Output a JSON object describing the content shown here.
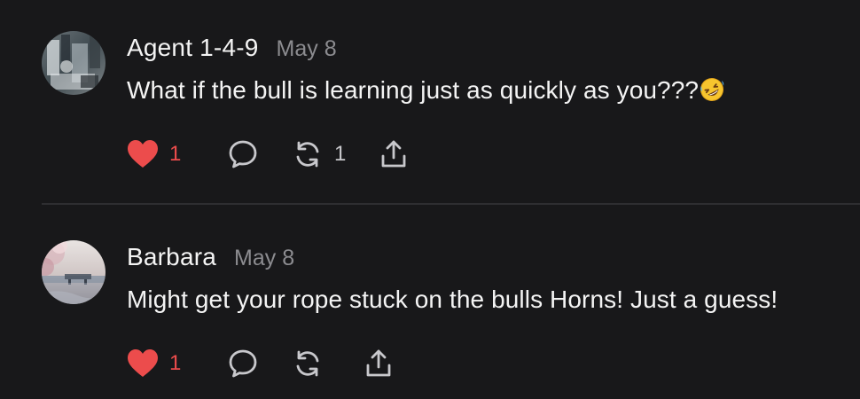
{
  "comments": [
    {
      "author": "Agent 1-4-9",
      "date": "May 8",
      "text": "What if the bull is learning just as quickly as you???",
      "emoji": "rolling-on-floor-laughing",
      "likes": "1",
      "restacks": "1",
      "liked": true
    },
    {
      "author": "Barbara",
      "date": "May 8",
      "text": "Might get your rope stuck on the bulls Horns! Just a guess!",
      "likes": "1",
      "restacks": "",
      "liked": true
    }
  ],
  "colors": {
    "background": "#18181a",
    "like_red": "#ec4c4c",
    "muted": "#8c8c90",
    "icon": "#c8c8cc",
    "divider": "#2e2e31"
  },
  "icons": [
    "heart-icon",
    "comment-bubble-icon",
    "restack-icon",
    "share-icon"
  ]
}
